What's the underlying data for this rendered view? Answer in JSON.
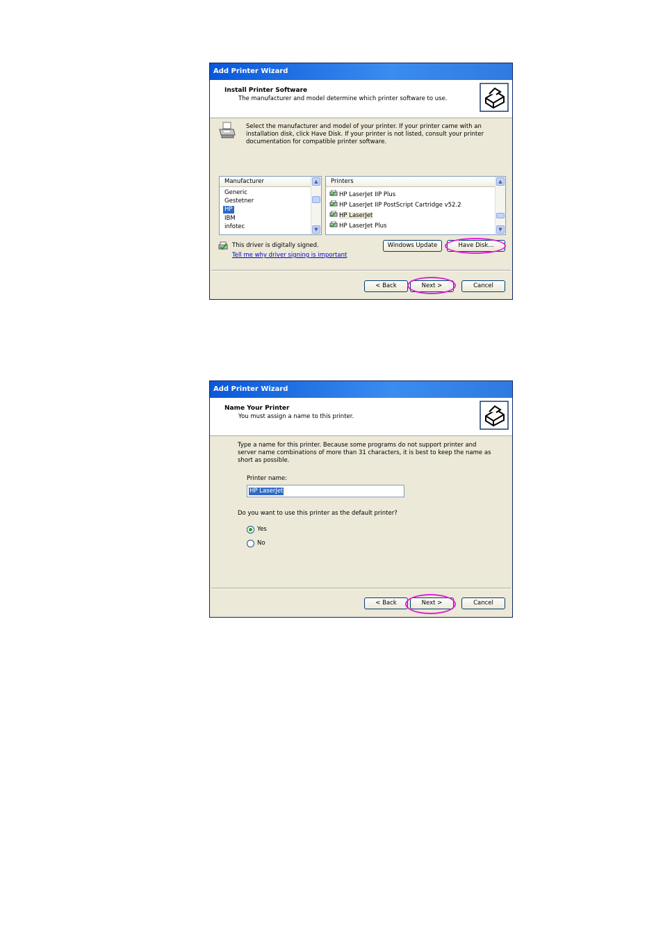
{
  "dialog1": {
    "title": "Add Printer Wizard",
    "header_title": "Install Printer Software",
    "header_subtitle": "The manufacturer and model determine which printer software to use.",
    "instructions": "Select the manufacturer and model of your printer. If your printer came with an installation disk, click Have Disk. If your printer is not listed, consult your printer documentation for compatible printer software.",
    "manufacturer_header": "Manufacturer",
    "manufacturers": [
      "Generic",
      "Gestetner",
      "HP",
      "IBM",
      "infotec"
    ],
    "selected_manufacturer": "HP",
    "printers_header": "Printers",
    "printers": [
      "HP LaserJet IIP Plus",
      "HP LaserJet IIP PostScript Cartridge v52.2",
      "HP LaserJet",
      "HP LaserJet Plus"
    ],
    "selected_printer": "HP LaserJet",
    "signed_text": "This driver is digitally signed.",
    "signing_link": "Tell me why driver signing is important",
    "windows_update_button": "Windows Update",
    "have_disk_button": "Have Disk...",
    "back_button": "< Back",
    "next_button": "Next >",
    "cancel_button": "Cancel"
  },
  "dialog2": {
    "title": "Add Printer Wizard",
    "header_title": "Name Your Printer",
    "header_subtitle": "You must assign a name to this printer.",
    "instructions": "Type a name for this printer. Because some programs do not support printer and server name combinations of more than 31 characters, it is best to keep the name as short as possible.",
    "printer_name_label": "Printer name:",
    "printer_name_value": "HP LaserJet",
    "default_question": "Do you want to use this printer as the default printer?",
    "option_yes": "Yes",
    "option_no": "No",
    "default_selected": "Yes",
    "back_button": "< Back",
    "next_button": "Next >",
    "cancel_button": "Cancel"
  },
  "colors": {
    "title_bar": "#0a58d8",
    "dialog_bg": "#ece9d8",
    "highlight_circle": "#e020d8",
    "selection": "#316ac5"
  }
}
